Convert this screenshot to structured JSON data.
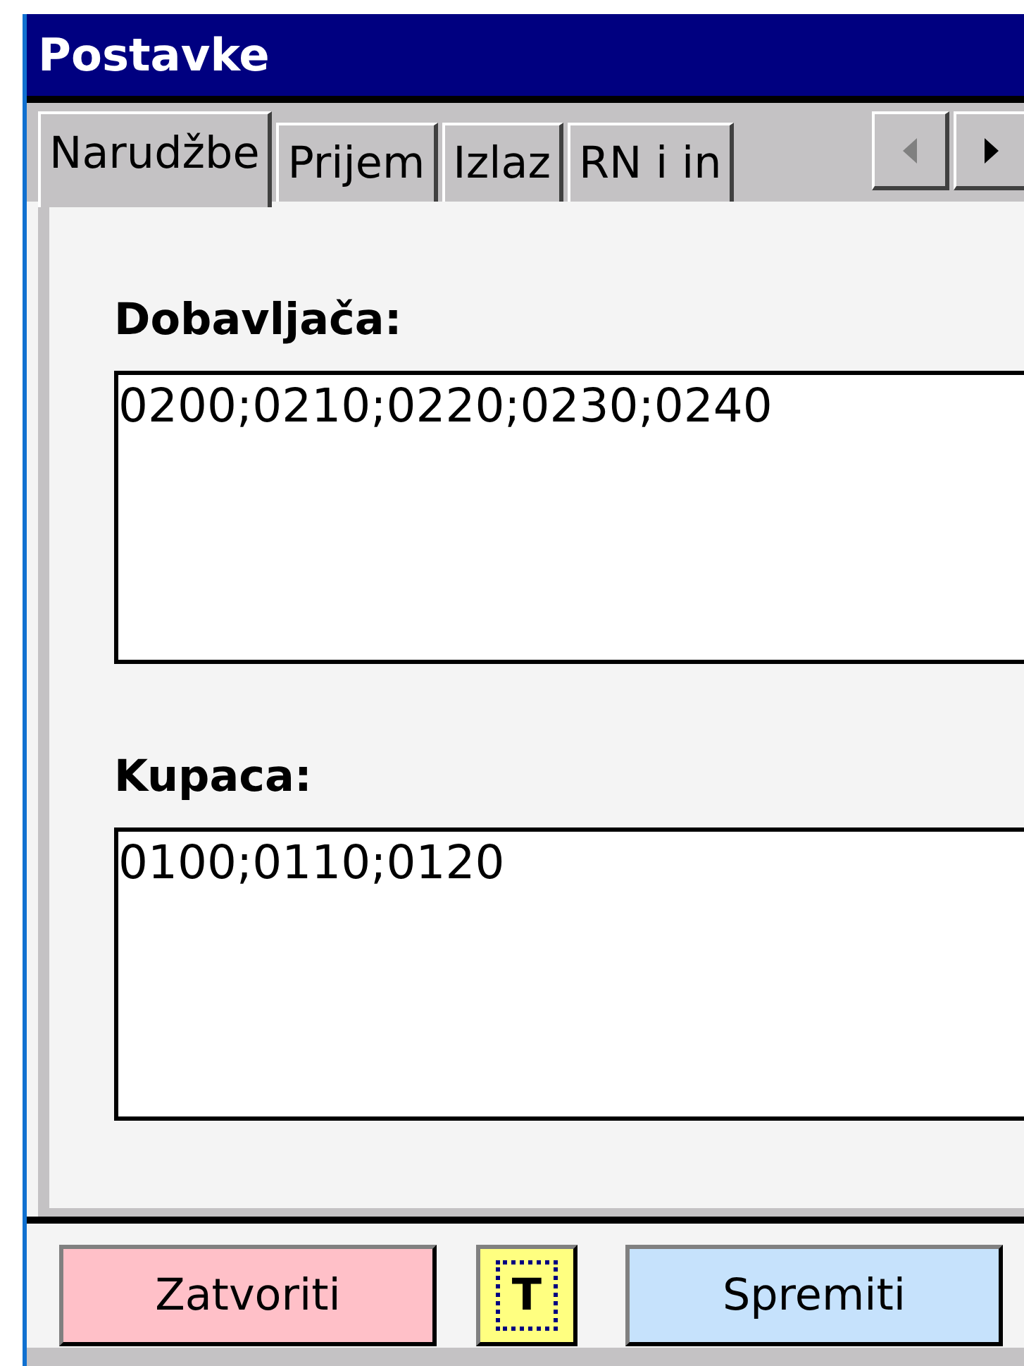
{
  "window": {
    "title": "Postavke"
  },
  "tabs": [
    {
      "label": "Narudžbe",
      "selected": true
    },
    {
      "label": "Prijem",
      "selected": false
    },
    {
      "label": "Izlaz",
      "selected": false
    },
    {
      "label": "RN i in",
      "selected": false
    }
  ],
  "tab_scroll": [
    {
      "kind": "left",
      "disabled": true
    },
    {
      "kind": "right",
      "disabled": false
    }
  ],
  "fields": [
    {
      "label": "Dobavljača:",
      "value": "0200;0210;0220;0230;0240"
    },
    {
      "label": "Kupaca:",
      "value": "0100;0110;0120"
    }
  ],
  "buttons": [
    {
      "label": "Zatvoriti",
      "kind": "close",
      "focused": false
    },
    {
      "label": "T",
      "kind": "keyboard",
      "focused": true
    },
    {
      "label": "Spremiti",
      "kind": "save",
      "focused": false
    }
  ]
}
